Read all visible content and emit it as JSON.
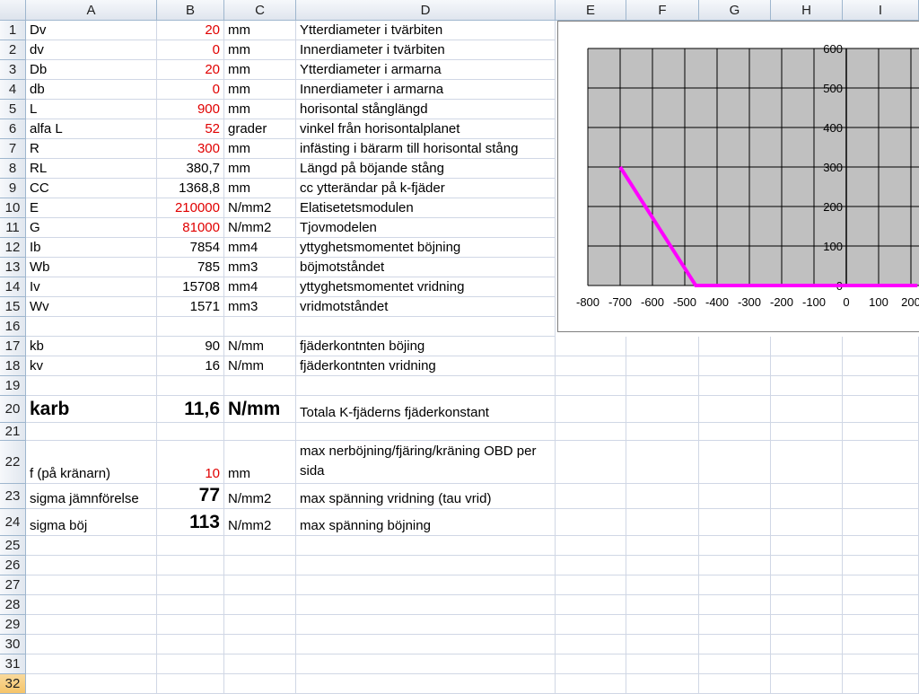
{
  "columns": [
    "A",
    "B",
    "C",
    "D",
    "E",
    "F",
    "G",
    "H",
    "I"
  ],
  "rows": [
    {
      "n": "1",
      "a": "Dv",
      "b": "20",
      "c": "mm",
      "d": "Ytterdiameter i tvärbiten",
      "red": true
    },
    {
      "n": "2",
      "a": "dv",
      "b": "0",
      "c": "mm",
      "d": "Innerdiameter i tvärbiten",
      "red": true
    },
    {
      "n": "3",
      "a": "Db",
      "b": "20",
      "c": "mm",
      "d": "Ytterdiameter i armarna",
      "red": true
    },
    {
      "n": "4",
      "a": "db",
      "b": "0",
      "c": "mm",
      "d": "Innerdiameter i armarna",
      "red": true
    },
    {
      "n": "5",
      "a": "L",
      "b": "900",
      "c": "mm",
      "d": "horisontal stånglängd",
      "red": true
    },
    {
      "n": "6",
      "a": "alfa L",
      "b": "52",
      "c": "grader",
      "d": "vinkel från horisontalplanet",
      "red": true
    },
    {
      "n": "7",
      "a": "R",
      "b": "300",
      "c": "mm",
      "d": "infästing i bärarm till horisontal stång",
      "red": true
    },
    {
      "n": "8",
      "a": "RL",
      "b": "380,7",
      "c": "mm",
      "d": "Längd på böjande stång",
      "red": false
    },
    {
      "n": "9",
      "a": "CC",
      "b": "1368,8",
      "c": "mm",
      "d": "cc ytterändar på k-fjäder",
      "red": false
    },
    {
      "n": "10",
      "a": "E",
      "b": "210000",
      "c": "N/mm2",
      "d": "Elatisetetsmodulen",
      "red": true
    },
    {
      "n": "11",
      "a": "G",
      "b": "81000",
      "c": "N/mm2",
      "d": "Tjovmodelen",
      "red": true
    },
    {
      "n": "12",
      "a": "Ib",
      "b": "7854",
      "c": "mm4",
      "d": "yttyghetsmomentet böjning",
      "red": false
    },
    {
      "n": "13",
      "a": "Wb",
      "b": "785",
      "c": "mm3",
      "d": "böjmotståndet",
      "red": false
    },
    {
      "n": "14",
      "a": "Iv",
      "b": "15708",
      "c": "mm4",
      "d": "yttyghetsmomentet vridning",
      "red": false
    },
    {
      "n": "15",
      "a": "Wv",
      "b": "1571",
      "c": "mm3",
      "d": "vridmotståndet",
      "red": false
    },
    {
      "n": "16",
      "a": "",
      "b": "",
      "c": "",
      "d": "",
      "red": false
    },
    {
      "n": "17",
      "a": "kb",
      "b": "90",
      "c": "N/mm",
      "d": "fjäderkontnten böjing",
      "red": false
    },
    {
      "n": "18",
      "a": "kv",
      "b": "16",
      "c": "N/mm",
      "d": "fjäderkontnten vridning",
      "red": false
    },
    {
      "n": "19",
      "a": "",
      "b": "",
      "c": "",
      "d": "",
      "red": false
    },
    {
      "n": "20",
      "a": "karb",
      "b": "11,6",
      "c": "N/mm",
      "d": "Totala K-fjäderns fjäderkonstant",
      "red": false,
      "big": true
    },
    {
      "n": "21",
      "a": "",
      "b": "",
      "c": "",
      "d": "",
      "red": false
    },
    {
      "n": "22",
      "a": "f (på kränarn)",
      "b": "10",
      "c": "mm",
      "d": "max nerböjning/fjäring/kräning OBD per sida",
      "red": true,
      "wrap": true
    },
    {
      "n": "23",
      "a": "sigma jämnförelse",
      "b": "77",
      "c": "N/mm2",
      "d": "max spänning vridning  (tau vrid)",
      "red": false,
      "bigb": true
    },
    {
      "n": "24",
      "a": "sigma böj",
      "b": "113",
      "c": "N/mm2",
      "d": "max spänning böjning",
      "red": false,
      "bigb": true
    },
    {
      "n": "25",
      "a": "",
      "b": "",
      "c": "",
      "d": "",
      "red": false
    },
    {
      "n": "26",
      "a": "",
      "b": "",
      "c": "",
      "d": "",
      "red": false
    },
    {
      "n": "27",
      "a": "",
      "b": "",
      "c": "",
      "d": "",
      "red": false
    },
    {
      "n": "28",
      "a": "",
      "b": "",
      "c": "",
      "d": "",
      "red": false
    },
    {
      "n": "29",
      "a": "",
      "b": "",
      "c": "",
      "d": "",
      "red": false
    },
    {
      "n": "30",
      "a": "",
      "b": "",
      "c": "",
      "d": "",
      "red": false
    },
    {
      "n": "31",
      "a": "",
      "b": "",
      "c": "",
      "d": "",
      "red": false
    },
    {
      "n": "32",
      "a": "",
      "b": "",
      "c": "",
      "d": "",
      "red": false,
      "active": true
    }
  ],
  "colors": {
    "input_red": "#e00000",
    "plot_bg": "#c0c0c0",
    "series": "#ff00ff",
    "gridline": "#000000"
  },
  "chart_data": {
    "type": "line",
    "title": "",
    "xlabel": "",
    "ylabel": "",
    "x_ticks": [
      "-800",
      "-700",
      "-600",
      "-500",
      "-400",
      "-300",
      "-200",
      "-100",
      "0",
      "100",
      "200"
    ],
    "y_ticks": [
      "0",
      "100",
      "200",
      "300",
      "400",
      "500",
      "600"
    ],
    "xlim": [
      -800,
      220
    ],
    "ylim": [
      0,
      600
    ],
    "grid": true,
    "series": [
      {
        "x": [
          -700,
          -466,
          220
        ],
        "y": [
          300,
          0,
          0
        ]
      }
    ]
  }
}
